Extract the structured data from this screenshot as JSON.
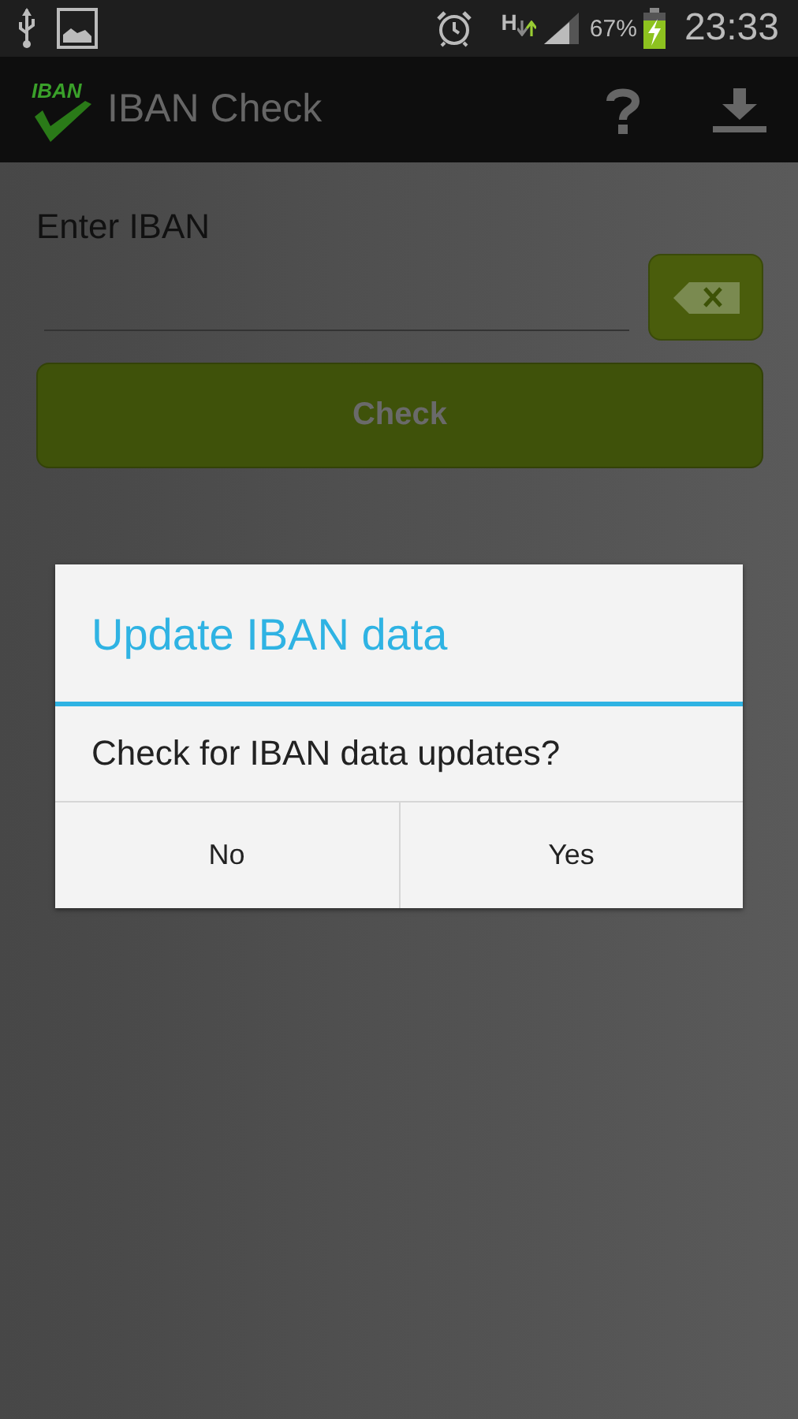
{
  "status_bar": {
    "network": "H",
    "battery": "67%",
    "time": "23:33"
  },
  "action_bar": {
    "logo_text": "IBAN",
    "title": "IBAN Check"
  },
  "form": {
    "label": "Enter IBAN",
    "check_button": "Check"
  },
  "dialog": {
    "title": "Update IBAN data",
    "message": "Check for IBAN data updates?",
    "buttons": [
      "No",
      "Yes"
    ]
  }
}
